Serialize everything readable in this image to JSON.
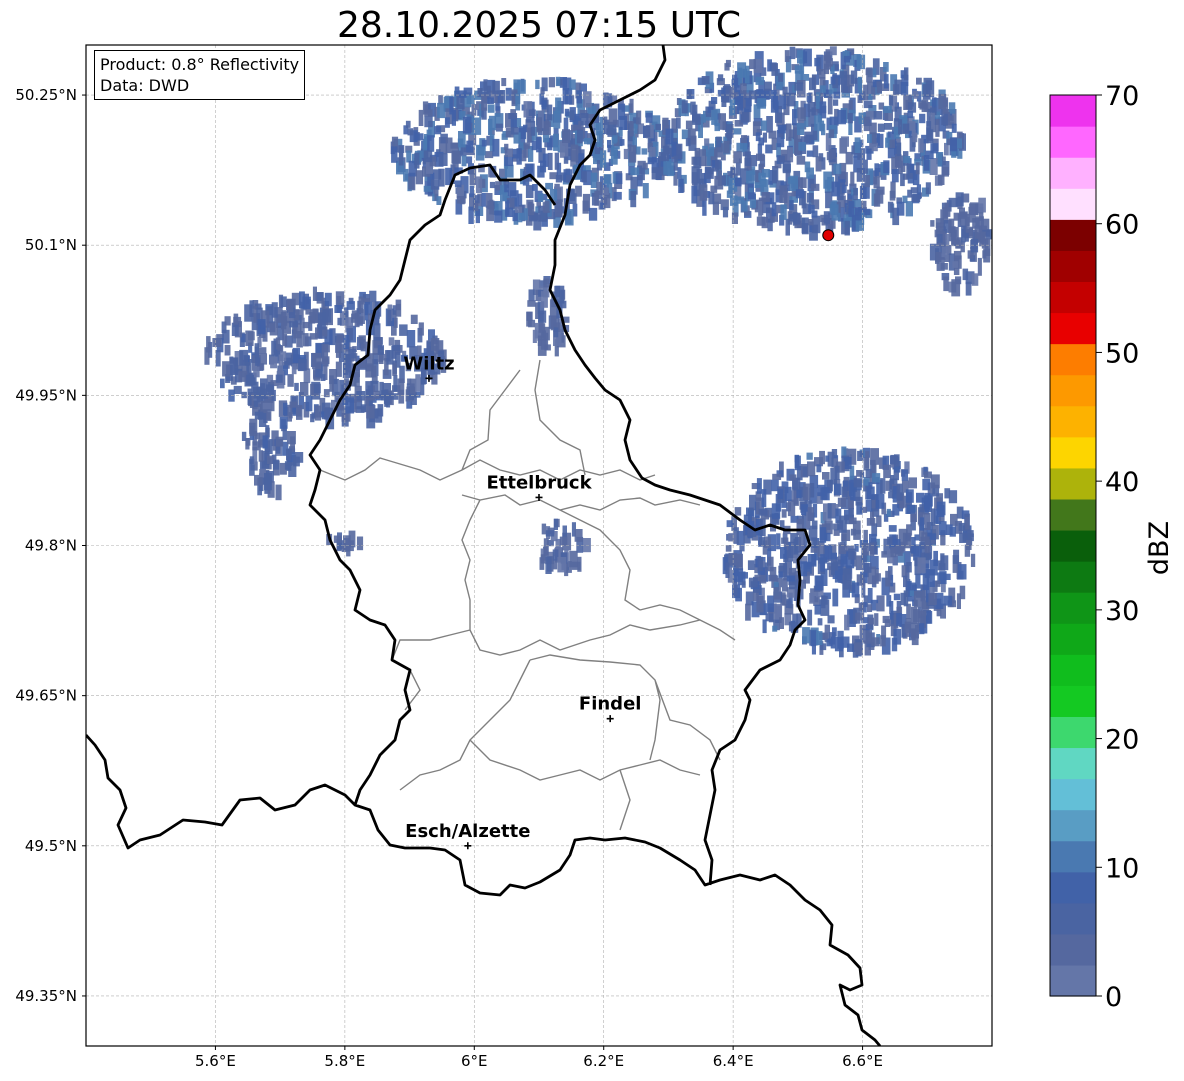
{
  "title": "28.10.2025 07:15 UTC",
  "info_box": {
    "product": "Product: 0.8° Reflectivity",
    "data_source": "Data: DWD"
  },
  "map": {
    "lon_range": [
      5.4,
      6.8
    ],
    "lat_range": [
      49.3,
      50.3
    ],
    "x_ticks": [
      {
        "value": 5.6,
        "label": "5.6°E"
      },
      {
        "value": 5.8,
        "label": "5.8°E"
      },
      {
        "value": 6.0,
        "label": "6°E"
      },
      {
        "value": 6.2,
        "label": "6.2°E"
      },
      {
        "value": 6.4,
        "label": "6.4°E"
      },
      {
        "value": 6.6,
        "label": "6.6°E"
      }
    ],
    "y_ticks": [
      {
        "value": 50.25,
        "label": "50.25°N"
      },
      {
        "value": 50.1,
        "label": "50.1°N"
      },
      {
        "value": 49.95,
        "label": "49.95°N"
      },
      {
        "value": 49.8,
        "label": "49.8°N"
      },
      {
        "value": 49.65,
        "label": "49.65°N"
      },
      {
        "value": 49.5,
        "label": "49.5°N"
      },
      {
        "value": 49.35,
        "label": "49.35°N"
      }
    ],
    "cities": [
      {
        "name": "Wiltz",
        "lon": 5.93,
        "lat": 49.967
      },
      {
        "name": "Ettelbruck",
        "lon": 6.1,
        "lat": 49.848
      },
      {
        "name": "Findel",
        "lon": 6.21,
        "lat": 49.627
      },
      {
        "name": "Esch/Alzette",
        "lon": 5.99,
        "lat": 49.5
      }
    ],
    "radar_marker": {
      "lon": 6.547,
      "lat": 50.11,
      "color": "#e00000"
    },
    "border_color": "#000000",
    "canton_color": "#808080",
    "grid": true
  },
  "colorbar": {
    "label": "dBZ",
    "min": 0,
    "max": 70,
    "tick_labels": [
      "0",
      "10",
      "20",
      "30",
      "40",
      "50",
      "60",
      "70"
    ],
    "colors": [
      "#6476a8",
      "#55689f",
      "#4a64a2",
      "#4162a8",
      "#4a79b1",
      "#599dc4",
      "#63bfd7",
      "#60d7c2",
      "#3dd86e",
      "#14c922",
      "#10bd1d",
      "#0fa818",
      "#0f9517",
      "#0d7a12",
      "#0a5f0b",
      "#42771b",
      "#adb30b",
      "#fdd500",
      "#fdb200",
      "#fd9900",
      "#fd7d00",
      "#e80000",
      "#c40000",
      "#a00000",
      "#7c0000",
      "#ffe0ff",
      "#ffb1ff",
      "#ff67ff",
      "#ee33ee"
    ]
  },
  "chart_data": {
    "type": "heatmap",
    "title": "28.10.2025 07:15 UTC",
    "xlabel": "",
    "ylabel": "",
    "xlim": [
      5.4,
      6.8
    ],
    "ylim": [
      49.3,
      50.3
    ],
    "value_label": "dBZ",
    "value_range": [
      0,
      70
    ],
    "precip_regions": [
      {
        "lon": [
          5.87,
          6.3
        ],
        "lat": [
          50.13,
          50.27
        ],
        "dbz": [
          2,
          12
        ]
      },
      {
        "lon": [
          6.28,
          6.75
        ],
        "lat": [
          50.12,
          50.3
        ],
        "dbz": [
          2,
          12
        ]
      },
      {
        "lon": [
          5.58,
          5.95
        ],
        "lat": [
          49.93,
          50.06
        ],
        "dbz": [
          2,
          8
        ]
      },
      {
        "lon": [
          5.64,
          5.73
        ],
        "lat": [
          49.86,
          49.95
        ],
        "dbz": [
          2,
          8
        ]
      },
      {
        "lon": [
          6.38,
          6.77
        ],
        "lat": [
          49.7,
          49.9
        ],
        "dbz": [
          2,
          10
        ]
      },
      {
        "lon": [
          6.09,
          6.17
        ],
        "lat": [
          49.78,
          49.83
        ],
        "dbz": [
          2,
          6
        ]
      },
      {
        "lon": [
          5.77,
          5.83
        ],
        "lat": [
          49.8,
          49.82
        ],
        "dbz": [
          2,
          6
        ]
      },
      {
        "lon": [
          6.7,
          6.8
        ],
        "lat": [
          50.06,
          50.16
        ],
        "dbz": [
          2,
          6
        ]
      },
      {
        "lon": [
          6.07,
          6.14
        ],
        "lat": [
          50.0,
          50.07
        ],
        "dbz": [
          2,
          6
        ]
      }
    ]
  }
}
